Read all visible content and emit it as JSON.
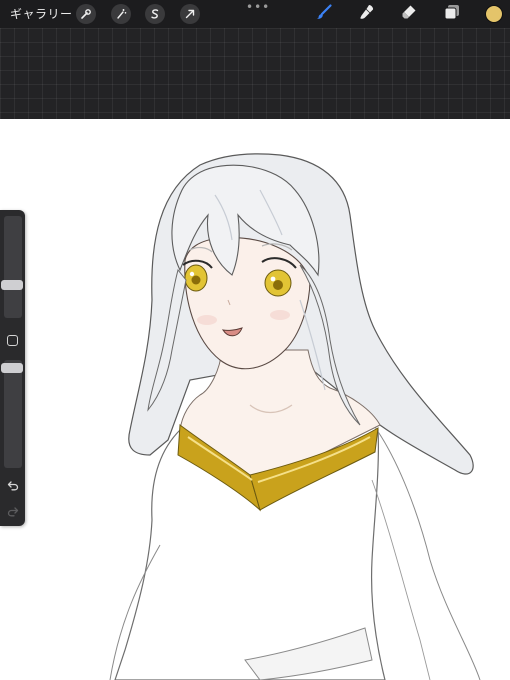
{
  "toolbar": {
    "gallery_label": "ギャラリー",
    "left_tools": [
      {
        "name": "actions",
        "icon": "wrench-icon"
      },
      {
        "name": "adjustments",
        "icon": "magic-wand-icon"
      },
      {
        "name": "selection",
        "icon": "selection-s-icon"
      },
      {
        "name": "transform",
        "icon": "arrow-cursor-icon"
      }
    ],
    "more_label": "•••",
    "right_tools": [
      {
        "name": "brush",
        "icon": "brush-icon",
        "active": true
      },
      {
        "name": "smudge",
        "icon": "smudge-icon",
        "active": false
      },
      {
        "name": "eraser",
        "icon": "eraser-icon",
        "active": false
      },
      {
        "name": "layers",
        "icon": "layers-icon",
        "active": false
      }
    ],
    "current_color": "#e4c46a"
  },
  "colors": {
    "toolbar_bg": "#1c1c1e",
    "accent_active": "#3b82f6",
    "gold_trim": "#c9a21c",
    "iris": "#e2c435",
    "skin": "#fbf0ea",
    "hair": "#eef0f3"
  },
  "sidebar": {
    "brush_size_level": 0.3,
    "brush_opacity_level": 0.03,
    "modify_icon": "square-icon",
    "undo_icon": "undo-icon",
    "redo_icon": "redo-icon",
    "redo_enabled": false
  }
}
